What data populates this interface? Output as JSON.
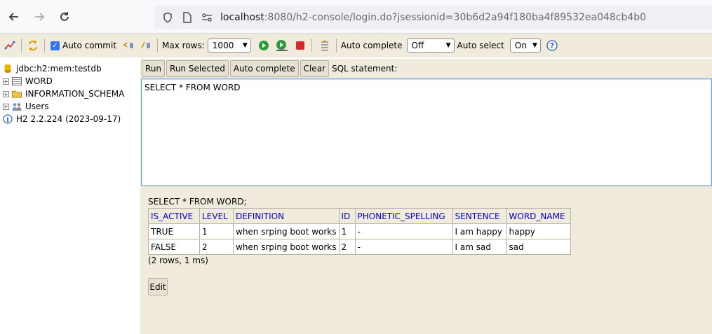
{
  "browser": {
    "url_host": "localhost",
    "url_rest": ":8080/h2-console/login.do?jsessionid=30b6d2a94f180ba4f89532ea048cb4b0"
  },
  "toolbar": {
    "auto_commit_label": "Auto commit",
    "max_rows_label": "Max rows:",
    "max_rows_value": "1000",
    "auto_complete_label": "Auto complete",
    "auto_complete_value": "Off",
    "auto_select_label": "Auto select",
    "auto_select_value": "On"
  },
  "tree": {
    "connection": "jdbc:h2:mem:testdb",
    "items": [
      {
        "label": "WORD"
      },
      {
        "label": "INFORMATION_SCHEMA"
      },
      {
        "label": "Users"
      }
    ],
    "version": "H2 2.2.224 (2023-09-17)"
  },
  "query": {
    "run": "Run",
    "run_selected": "Run Selected",
    "auto_complete": "Auto complete",
    "clear": "Clear",
    "sql_label": "SQL statement:",
    "sql_text": "SELECT * FROM WORD"
  },
  "results": {
    "executed_sql": "SELECT * FROM WORD;",
    "columns": [
      "IS_ACTIVE",
      "LEVEL",
      "DEFINITION",
      "ID",
      "PHONETIC_SPELLING",
      "SENTENCE",
      "WORD_NAME"
    ],
    "rows": [
      [
        "TRUE",
        "1",
        "when srping boot works",
        "1",
        "-",
        "I am happy",
        "happy"
      ],
      [
        "FALSE",
        "2",
        "when srping boot works",
        "2",
        "-",
        "I am sad",
        "sad"
      ]
    ],
    "summary": "(2 rows, 1 ms)",
    "edit": "Edit"
  },
  "colors": {
    "panel_bg": "#f0ebdc",
    "header_text": "#0000cc"
  }
}
